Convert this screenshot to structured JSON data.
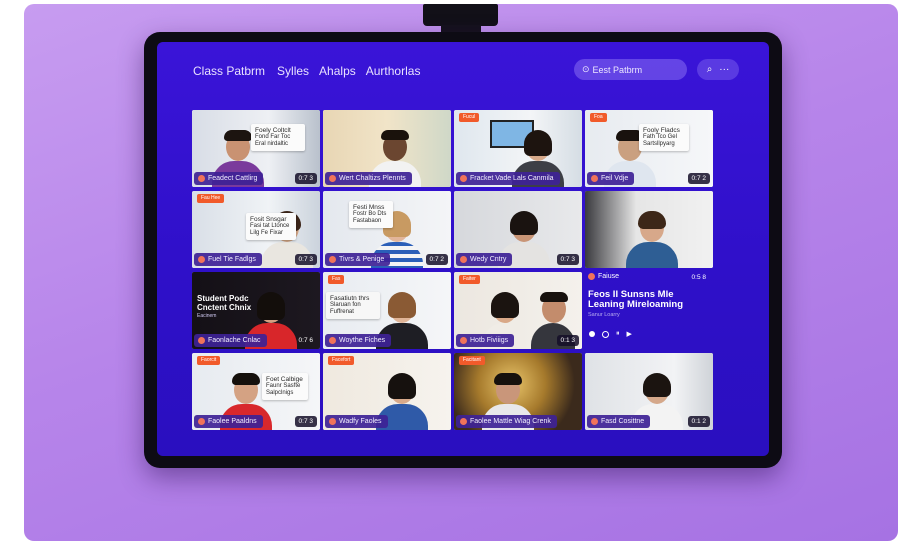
{
  "header": {
    "nav": [
      "Class Patbrm",
      "Sylles",
      "Ahalps",
      "Aurthorlas"
    ],
    "search_placeholder": "Eest Patbrm",
    "search_icon": "search-icon",
    "more_icon": "more-icon"
  },
  "tiles": [
    {
      "label": "Feadect Cattlirg",
      "time": "0:7 3",
      "card": [
        "Foely Coltclt",
        "Fond Far Toc",
        "Eral nirdaltic"
      ],
      "tag": ""
    },
    {
      "label": "Wert Chaltizs Plennts",
      "time": "",
      "card": [],
      "tag": ""
    },
    {
      "label": "Fracket Vade Lals Canmila",
      "time": "",
      "card": [],
      "tag": "Fucul"
    },
    {
      "label": "Feil Vdje",
      "time": "0:7 2",
      "card": [
        "Fooly Fladcs",
        "Fath Tco Gel",
        "Sartsllpyarg"
      ],
      "tag": "Foa"
    },
    {
      "label": "Fuel Tie Fadlgs",
      "time": "0:7 3",
      "card": [
        "Fosit Snsgar",
        "Fasi tat Ltonce",
        "Lilg Fe Fixar"
      ],
      "tag": "Fau Hee"
    },
    {
      "label": "Tivrs & Penige",
      "time": "0:7 2",
      "card": [
        "Festi Mnss",
        "Fostr Bo Dts",
        "Fastabaon"
      ],
      "tag": ""
    },
    {
      "label": "Wedy Cntry",
      "time": "0:7 3",
      "card": [],
      "tag": ""
    },
    {
      "label": "Falsnu",
      "time": "0:5 8",
      "card": [],
      "tag": ""
    },
    {
      "label": "Faonlache Cnlac",
      "time": "0:7 6",
      "card": [],
      "tag": "",
      "overlay": [
        "Student Podc",
        "Cnctent Chnix",
        "Eacinem"
      ]
    },
    {
      "label": "Woythe Fiches",
      "time": "",
      "card": [
        "Fasatiutn thrs",
        "Slaruan fon",
        "Fuffrenat"
      ],
      "tag": "Fas"
    },
    {
      "label": "Hotb Fiviiigs",
      "time": "0:1 3",
      "card": [],
      "tag": "Faiter"
    },
    {
      "label": "",
      "time": "",
      "card": [],
      "tag": ""
    },
    {
      "label": "Faolee Paaldns",
      "time": "0:7 3",
      "card": [
        "Foet Calbige",
        "Faunr Sasfte",
        "Salpclnigs"
      ],
      "tag": "Faorcit"
    },
    {
      "label": "Wadfy Faoles",
      "time": "",
      "card": [],
      "tag": "Facefort"
    },
    {
      "label": "Faolee Mattle Wiag Crenk",
      "time": "",
      "card": [],
      "tag": "Facitant"
    },
    {
      "label": "Fasd Cosittne",
      "time": "0:1 2",
      "card": [],
      "tag": ""
    }
  ],
  "promo": {
    "label": "Faiuse",
    "time": "0:5 8",
    "title": "Feos II Sunsns Mle Leaning Mireloaming",
    "subtitle": "Sanur Loarry",
    "controls": [
      "⏸",
      "▶︎"
    ]
  },
  "colors": {
    "accent": "#3a14d8",
    "label_bar": "#3e2296",
    "badge": "#f15a2a"
  }
}
